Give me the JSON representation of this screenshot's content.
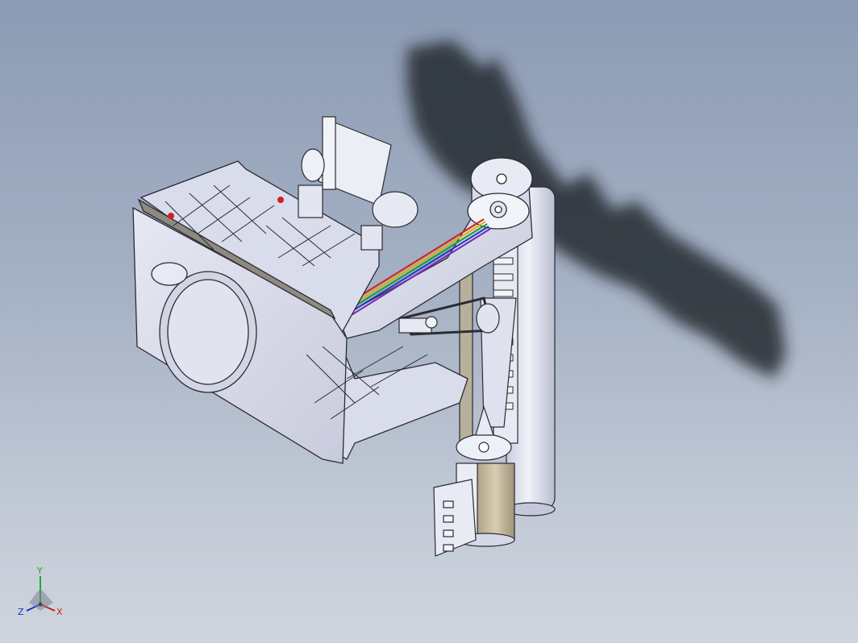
{
  "view": {
    "background_top": "#8c9bb4",
    "background_bottom": "#cfd5de"
  },
  "model": {
    "part_color": "#dcdfee",
    "edge_color": "#2b2b33",
    "shadow_color": "#1e2026",
    "cable_colors": [
      "#d02020",
      "#e0b000",
      "#1a9a2a",
      "#1a3ad0",
      "#7a2ab0",
      "#222222"
    ],
    "spring_color": "#c9bfa4"
  },
  "triad": {
    "x_label": "X",
    "y_label": "Y",
    "z_label": "Z",
    "x_color": "#d01818",
    "y_color": "#18b018",
    "z_color": "#1830d0"
  }
}
